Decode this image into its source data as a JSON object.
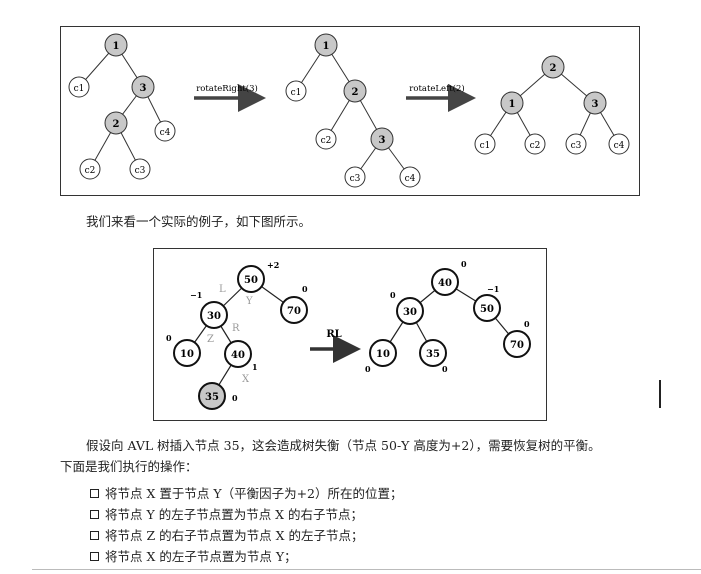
{
  "figure1": {
    "arrow1_label": "rotateRight(3)",
    "arrow2_label": "rotateLeft(2)",
    "tree1": {
      "n1": "1",
      "c1": "c1",
      "n3": "3",
      "n2": "2",
      "c4": "c4",
      "c2": "c2",
      "c3": "c3"
    },
    "tree2": {
      "n1": "1",
      "c1": "c1",
      "n2": "2",
      "c2": "c2",
      "n3": "3",
      "c3": "c3",
      "c4": "c4"
    },
    "tree3": {
      "n2": "2",
      "n1": "1",
      "n3": "3",
      "c1": "c1",
      "c2": "c2",
      "c3": "c3",
      "c4": "c4"
    }
  },
  "intro_text": "我们来看一个实际的例子，如下图所示。",
  "figure2": {
    "arrow_label": "RL",
    "left": {
      "n50": "50",
      "bf50": "+2",
      "n70": "70",
      "bf70": "0",
      "n30": "30",
      "bf30": "−1",
      "n10": "10",
      "bf10": "0",
      "n40": "40",
      "bf40": "1",
      "n35": "35",
      "bf35": "0",
      "lbl_L": "L",
      "lbl_Y": "Y",
      "lbl_R": "R",
      "lbl_Z": "Z",
      "lbl_X": "X"
    },
    "right": {
      "n40": "40",
      "bf40": "0",
      "n30": "30",
      "bf30": "0",
      "n50": "50",
      "bf50": "−1",
      "n10": "10",
      "bf10": "0",
      "n35": "35",
      "bf35": "0",
      "n70": "70",
      "bf70": "0"
    }
  },
  "paragraph_line1": "假设向 AVL 树插入节点 35，这会造成树失衡（节点 50-Y 高度为+2），需要恢复树的平衡。",
  "paragraph_line2": "下面是我们执行的操作：",
  "bullets": [
    "将节点 X 置于节点 Y（平衡因子为+2）所在的位置；",
    "将节点 Y 的左子节点置为节点 X 的右子节点；",
    "将节点 Z 的右子节点置为节点 X 的左子节点；",
    "将节点 X 的左子节点置为节点 Y；"
  ]
}
